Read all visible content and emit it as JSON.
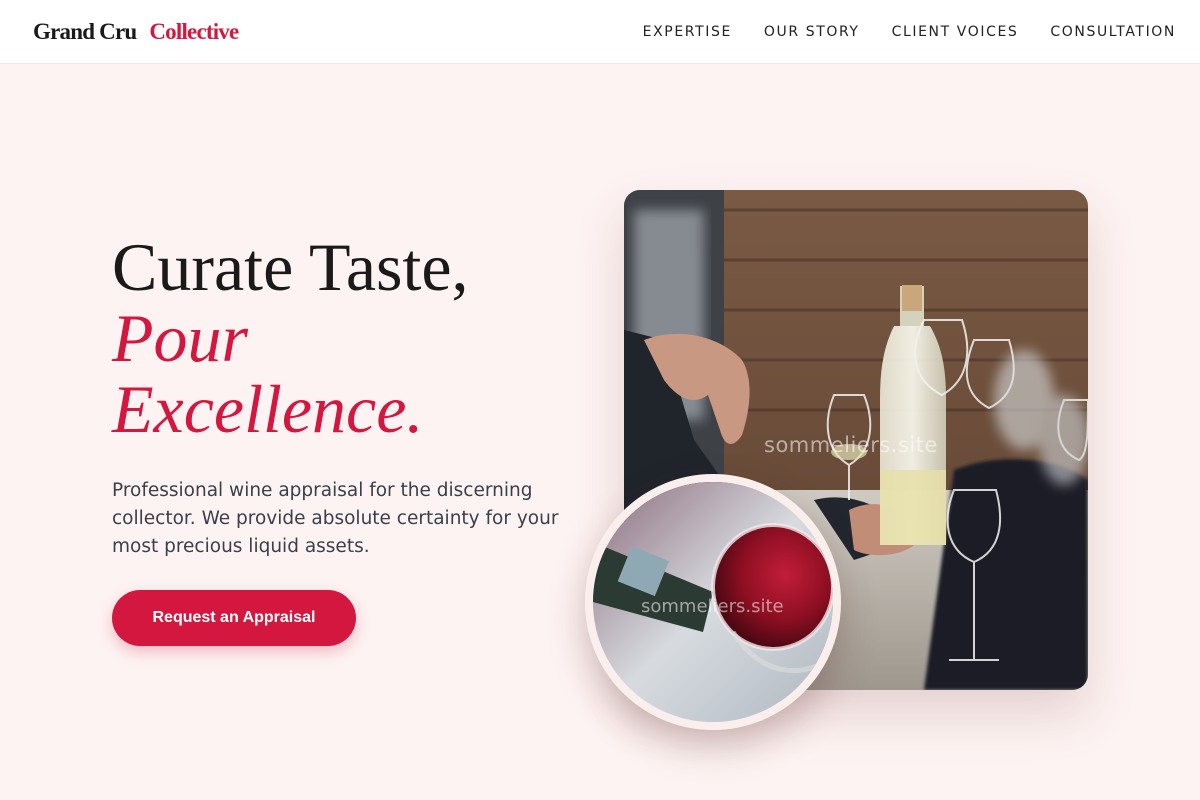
{
  "header": {
    "logo_part1": "Grand Cru",
    "logo_part2": "Collective",
    "nav": [
      "EXPERTISE",
      "OUR STORY",
      "CLIENT VOICES",
      "CONSULTATION"
    ]
  },
  "hero": {
    "headline_line1": "Curate Taste,",
    "headline_line2": "Pour",
    "headline_line3": "Excellence.",
    "lede": "Professional wine appraisal for the discerning collector. We provide absolute certainty for your most precious liquid assets.",
    "cta_label": "Request an Appraisal"
  },
  "images": {
    "watermark": "sommeliers.site"
  },
  "colors": {
    "accent": "#d3173f",
    "background": "#fdf3f2",
    "header_bg": "#ffffff",
    "text_dark": "#1a1a1a",
    "text_body": "#3a3f4a"
  }
}
